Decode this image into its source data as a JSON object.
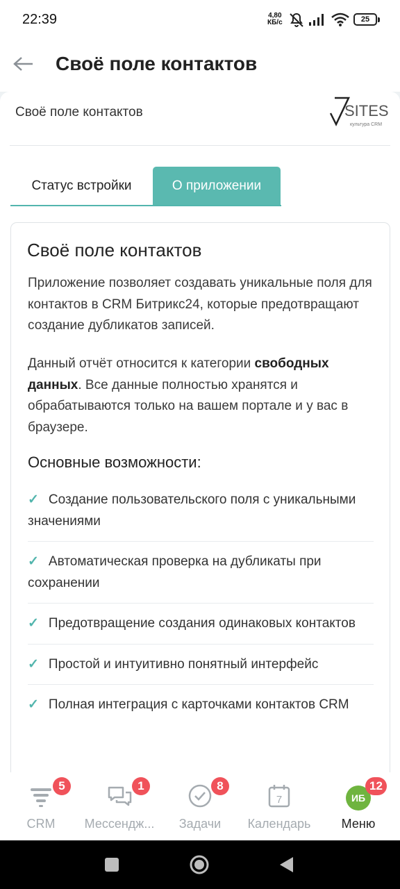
{
  "status_bar": {
    "time": "22:39",
    "net_speed_value": "4,80",
    "net_speed_unit": "КБ/с",
    "battery": "25",
    "icons": [
      "mute-icon",
      "signal-icon",
      "wifi-icon",
      "battery-icon"
    ]
  },
  "app_bar": {
    "title": "Своё поле контактов",
    "back_icon": "arrow-left-icon"
  },
  "app_header": {
    "name": "Своё поле контактов",
    "logo_mark": "7",
    "logo_text": "SITES",
    "logo_subtext": "культура CRM"
  },
  "tabs": [
    {
      "label": "Статус встройки",
      "active": false
    },
    {
      "label": "О приложении",
      "active": true
    }
  ],
  "about": {
    "title": "Своё поле контактов",
    "paragraph1": "Приложение позволяет создавать уникальные поля для контактов в CRM Битрикс24, которые предотвращают создание дубликатов записей.",
    "paragraph2_start": "Данный отчёт относится к категории ",
    "paragraph2_bold": "свободных данных",
    "paragraph2_end": ". Все данные полностью хранятся и обрабатываются только на вашем портале и у вас в браузере.",
    "features_title": "Основные возможности:",
    "check_mark": "✓",
    "features": [
      "Создание пользовательского поля с уникальными значениями",
      "Автоматическая проверка на дубликаты при сохранении",
      "Предотвращение создания одинаковых контактов",
      "Простой и интуитивно понятный интерфейс",
      "Полная интеграция с карточками контактов CRM"
    ]
  },
  "bottom_nav": {
    "accent": "#52b5ad",
    "badge_color": "#f0525a",
    "items": [
      {
        "label": "CRM",
        "badge": "5",
        "icon": "crm-funnel-icon"
      },
      {
        "label": "Мессендж...",
        "badge": "1",
        "icon": "chat-icon"
      },
      {
        "label": "Задачи",
        "badge": "8",
        "icon": "task-check-icon"
      },
      {
        "label": "Календарь",
        "badge": "",
        "icon": "calendar-icon",
        "calendar_day": "7"
      },
      {
        "label": "Меню",
        "badge": "12",
        "icon": "avatar",
        "avatar_initials": "ИБ"
      }
    ]
  },
  "system_nav": [
    "recents-button",
    "home-button",
    "back-button"
  ]
}
